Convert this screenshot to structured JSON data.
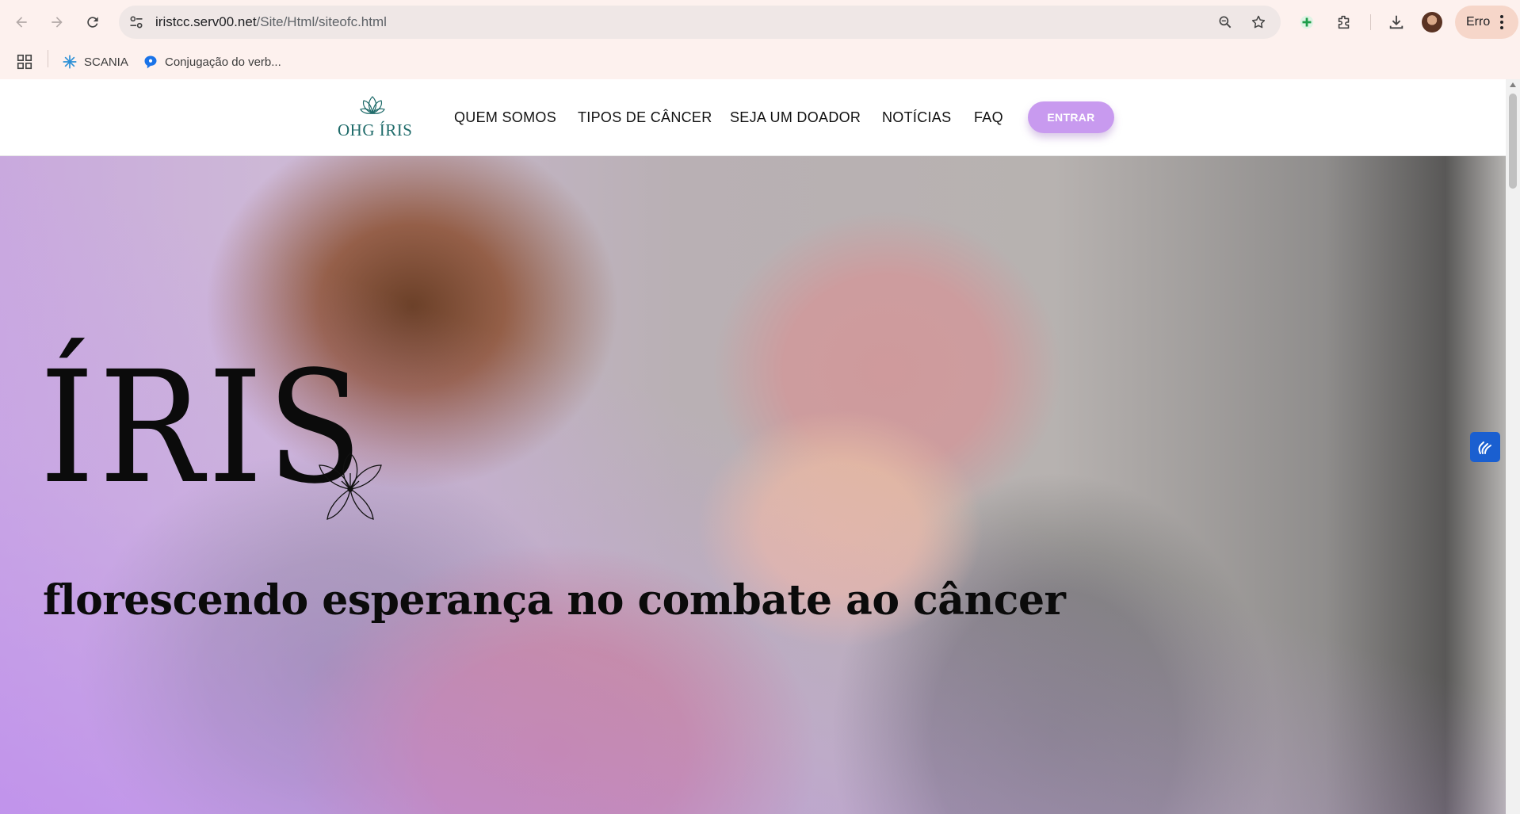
{
  "browser": {
    "url_host": "iristcc.serv00.net",
    "url_path": "/Site/Html/siteofc.html",
    "profile_label": "Erro",
    "bookmarks": [
      {
        "label": "SCANIA",
        "icon": "scania-icon"
      },
      {
        "label": "Conjugação do verb...",
        "icon": "speech-bubble-icon"
      }
    ]
  },
  "site": {
    "logo_text": "OHG ÍRIS",
    "nav": [
      "QUEM SOMOS",
      "TIPOS DE CÂNCER",
      "SEJA UM DOADOR",
      "NOTÍCIAS",
      "FAQ"
    ],
    "login_label": "ENTRAR",
    "accent_color": "#c89aef"
  },
  "hero": {
    "title": "ÍRIS",
    "subtitle": "florescendo esperança no combate ao câncer"
  }
}
